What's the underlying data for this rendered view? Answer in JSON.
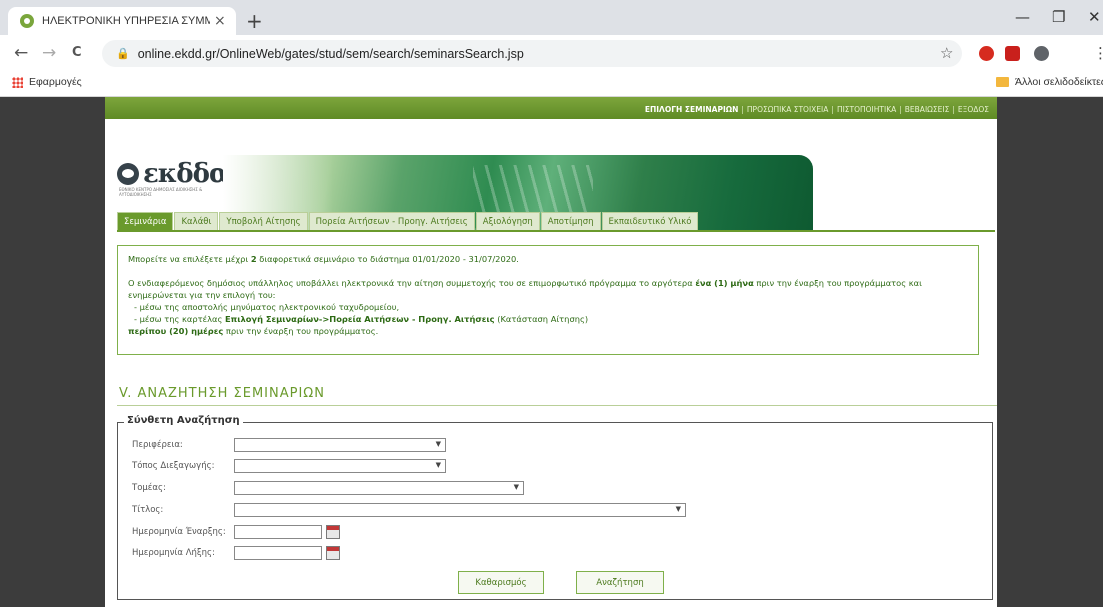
{
  "browser": {
    "tab_title": "ΗΛΕΚΤΡΟΝΙΚΗ ΥΠΗΡΕΣΙΑ ΣΥΜΜ",
    "tab_close": "×",
    "new_tab": "+",
    "url": "online.ekdd.gr/OnlineWeb/gates/stud/sem/search/seminarsSearch.jsp",
    "bookmarks": {
      "apps": "Εφαρμογές",
      "other": "Άλλοι σελιδοδείκτες"
    },
    "controls": {
      "minimize": "—",
      "maximize": "❐",
      "close": "✕",
      "back": "←",
      "forward": "→",
      "reload": "C",
      "star": "☆",
      "kebab": "⋮"
    }
  },
  "site": {
    "logo_text": "εκδδα",
    "logo_subtitle": "ΕΘΝΙΚΟ ΚΕΝΤΡΟ ΔΗΜΟΣΙΑΣ ΔΙΟΙΚΗΣΗΣ & ΑΥΤΟΔΙΟΙΚΗΣΗΣ",
    "top_nav": [
      "ΕΠΙΛΟΓΗ ΣΕΜΙΝΑΡΙΩΝ",
      "ΠΡΟΣΩΠΙΚΑ ΣΤΟΙΧΕΙΑ",
      "ΠΙΣΤΟΠΟΙΗΤΙΚΑ",
      "ΒΕΒΑΙΩΣΕΙΣ",
      "ΕΞΟΔΟΣ"
    ],
    "tabs": [
      "Σεμινάρια",
      "Καλάθι",
      "Υποβολή Αίτησης",
      "Πορεία Αιτήσεων - Προηγ. Αιτήσεις",
      "Αξιολόγηση",
      "Αποτίμηση",
      "Εκπαιδευτικό Υλικό"
    ]
  },
  "info": {
    "line1_a": "Μπορείτε να επιλέξετε μέχρι ",
    "line1_b": "2",
    "line1_c": " διαφορετικά σεμινάριο το διάστημα 01/01/2020 - 31/07/2020.",
    "line2_a": "Ο ενδιαφερόμενος δημόσιος υπάλληλος υποβάλλει ηλεκτρονικά την αίτηση συμμετοχής του σε επιμορφωτικό πρόγραμμα το αργότερα ",
    "line2_b": "ένα (1) μήνα",
    "line2_c": " πριν την έναρξη του προγράμματος και",
    "line3": "ενημερώνεται για την επιλογή του:",
    "line4": "- μέσω της αποστολής μηνύματος ηλεκτρονικού ταχυδρομείου,",
    "line5_a": "- μέσω της καρτέλας ",
    "line5_b": "Επιλογή Σεμιναρίων->Πορεία Αιτήσεων - Προηγ. Αιτήσεις",
    "line5_c": " (Κατάσταση Αίτησης)",
    "line6_a": "περίπου (20) ημέρες",
    "line6_b": " πριν την έναρξη του προγράμματος."
  },
  "search": {
    "section_title": "V. ΑΝΑΖΗΤΗΣΗ ΣΕΜΙΝΑΡΙΩΝ",
    "legend": "Σύνθετη Αναζήτηση",
    "fields": {
      "region": "Περιφέρεια:",
      "venue": "Τόπος Διεξαγωγής:",
      "sector": "Τομέας:",
      "title": "Τίτλος:",
      "start_date": "Ημερομηνία Έναρξης:",
      "end_date": "Ημερομηνία Λήξης:"
    },
    "clear_button": "Καθαρισμός",
    "search_button": "Αναζήτηση",
    "dropdown_arrow": "▼"
  },
  "colors": {
    "accent": "#6a9a2c",
    "text_green": "#2d6a14",
    "border_green": "#7fb04a"
  }
}
